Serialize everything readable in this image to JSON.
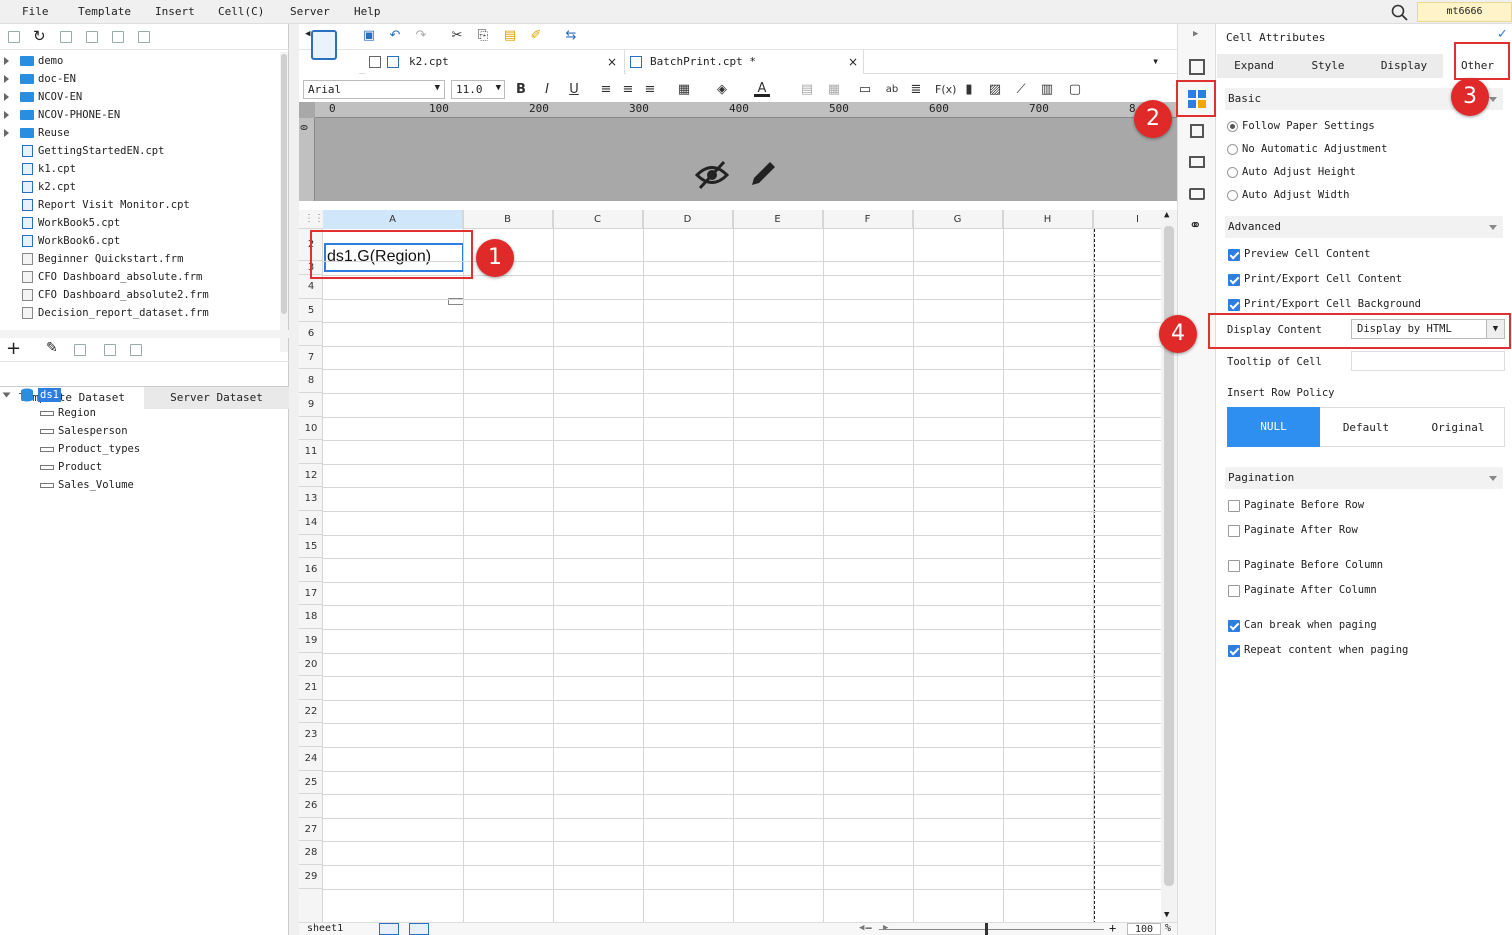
{
  "menu": [
    "File",
    "Template",
    "Insert",
    "Cell(C)",
    "Server",
    "Help"
  ],
  "user": "mt6666",
  "file_tree": [
    {
      "type": "folder",
      "label": "demo"
    },
    {
      "type": "folder",
      "label": "doc-EN"
    },
    {
      "type": "folder",
      "label": "NCOV-EN"
    },
    {
      "type": "folder",
      "label": "NCOV-PHONE-EN"
    },
    {
      "type": "folder",
      "label": "Reuse"
    },
    {
      "type": "cpt",
      "label": "GettingStartedEN.cpt"
    },
    {
      "type": "cpt",
      "label": "k1.cpt"
    },
    {
      "type": "cpt",
      "label": "k2.cpt"
    },
    {
      "type": "cpt",
      "label": "Report Visit Monitor.cpt"
    },
    {
      "type": "cpt",
      "label": "WorkBook5.cpt"
    },
    {
      "type": "cpt",
      "label": "WorkBook6.cpt"
    },
    {
      "type": "frm",
      "label": "Beginner Quickstart.frm"
    },
    {
      "type": "frm",
      "label": "CFO Dashboard_absolute.frm"
    },
    {
      "type": "frm",
      "label": "CFO Dashboard_absolute2.frm"
    },
    {
      "type": "frm",
      "label": "Decision_report_dataset.frm"
    }
  ],
  "dataset_tabs": {
    "template": "Template Dataset",
    "server": "Server Dataset"
  },
  "dataset": {
    "name": "ds1",
    "fields": [
      "Region",
      "Salesperson",
      "Product_types",
      "Product",
      "Sales_Volume"
    ]
  },
  "tabs": [
    {
      "label": "k2.cpt"
    },
    {
      "label": "BatchPrint.cpt *"
    }
  ],
  "font": {
    "name": "Arial",
    "size": "11.0"
  },
  "ruler": [
    "0",
    "100",
    "200",
    "300",
    "400",
    "500",
    "600",
    "700",
    "8"
  ],
  "columns": [
    "A",
    "B",
    "C",
    "D",
    "E",
    "F",
    "G",
    "H",
    "I"
  ],
  "rows": [
    "2",
    "3",
    "4",
    "5",
    "6",
    "7",
    "8",
    "9",
    "10",
    "11",
    "12",
    "13",
    "14",
    "15",
    "16",
    "17",
    "18",
    "19",
    "20",
    "21",
    "22",
    "23",
    "24",
    "25",
    "26",
    "27",
    "28",
    "29"
  ],
  "cell_a2": "ds1.G(Region)",
  "sheet": {
    "tab": "sheet1",
    "zoom": "100",
    "zoom_unit": "%"
  },
  "right": {
    "title": "Cell Attributes",
    "tabs": [
      "Expand",
      "Style",
      "Display",
      "Other"
    ],
    "basic": {
      "heading": "Basic",
      "options": [
        "Follow Paper Settings",
        "No Automatic Adjustment",
        "Auto Adjust Height",
        "Auto Adjust Width"
      ]
    },
    "advanced": {
      "heading": "Advanced",
      "checks": [
        "Preview Cell Content",
        "Print/Export Cell Content",
        "Print/Export Cell Background"
      ],
      "display_content_label": "Display Content",
      "display_content_value": "Display by HTML",
      "tooltip_label": "Tooltip of Cell",
      "insert_row_label": "Insert Row Policy",
      "insert_row_opts": [
        "NULL",
        "Default",
        "Original"
      ]
    },
    "pagination": {
      "heading": "Pagination",
      "checks": [
        "Paginate Before Row",
        "Paginate After Row",
        "Paginate Before Column",
        "Paginate After Column",
        "Can break when paging",
        "Repeat content when paging"
      ]
    }
  },
  "badges": [
    "1",
    "2",
    "3",
    "4"
  ],
  "colors": {
    "accent": "#2e7de0",
    "badge": "#e02a2a",
    "selected_header": "#cfe6fb"
  }
}
